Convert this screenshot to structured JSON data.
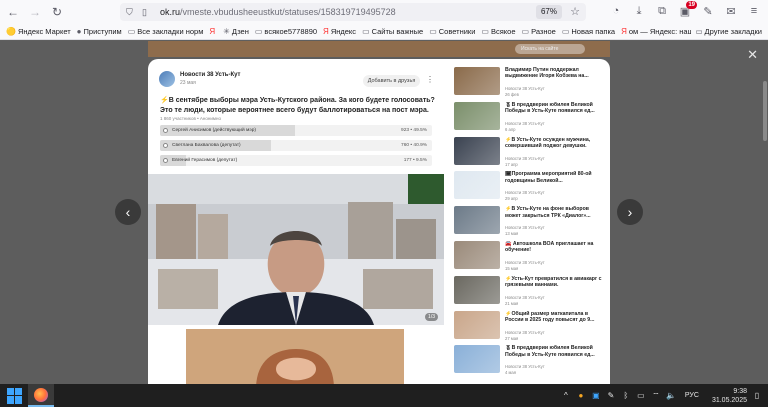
{
  "browser": {
    "url_domain": "ok.ru",
    "url_path": "/vmeste.vbudusheeustkut/statuses/158319719495728",
    "zoom": "67%",
    "notif_badge": "19"
  },
  "bookmarks": {
    "items": [
      {
        "icon": "yandex-icon",
        "label": "Яндекс Маркет"
      },
      {
        "icon": "pin-icon",
        "label": "Приступим"
      },
      {
        "icon": "folder-icon",
        "label": "Все закладки норм"
      },
      {
        "icon": "yandex-icon",
        "label": ""
      },
      {
        "icon": "zen-icon",
        "label": "Дзен"
      },
      {
        "icon": "folder-icon",
        "label": "всякое5778890"
      },
      {
        "icon": "yandex-icon",
        "label": "Яндекс"
      },
      {
        "icon": "folder-icon",
        "label": "Сайты важные"
      },
      {
        "icon": "folder-icon",
        "label": "Советники"
      },
      {
        "icon": "folder-icon",
        "label": "Всякое"
      },
      {
        "icon": "folder-icon",
        "label": "Разное"
      },
      {
        "icon": "folder-icon",
        "label": "Новая папка"
      },
      {
        "icon": "yandex-icon",
        "label": "ом — Яндекс: нашло..."
      }
    ],
    "other": "Другие закладки"
  },
  "page": {
    "search_placeholder": "Искать на сайте"
  },
  "post": {
    "group_name": "Новости 38 Усть-Кут",
    "date": "23 мая",
    "add_friend": "Добавить в друзья",
    "title": "⚡В сентябре выборы мэра Усть-Кутского района. За кого будете голосовать? Это те люди, которые вероятнее всего будут баллотироваться на пост мэра.",
    "poll_meta": "1 860 участников • Анонимно",
    "poll": [
      {
        "label": "Сергей Анисимов (действующий мэр)",
        "value": "923 • 49.5%",
        "percent": 49.5
      },
      {
        "label": "Светлана Бахвалова (депутат)",
        "value": "760 • 40.9%",
        "percent": 40.9
      },
      {
        "label": "Евгений Герасимов (депутат)",
        "value": "177 • 9.5%",
        "percent": 9.5
      }
    ],
    "photo_counter": "1/3"
  },
  "news": [
    {
      "title": "Владимир Путин поддержал выдвижение Игоря Кобзева на...",
      "source": "Новости 38 Усть-Кут",
      "date": "26 фев",
      "thumb": "#8a6a4a"
    },
    {
      "title": "🎖В преддверии юбилея Великой Победы в Усть-Куте появился ед...",
      "source": "Новости 38 Усть-Кут",
      "date": "6 апр",
      "thumb": "#7b8f6b"
    },
    {
      "title": "⚡В Усть-Куте осужден мужчина, совершивший поджог девушки.",
      "source": "Новости 38 Усть-Кут",
      "date": "17 апр",
      "thumb": "#3a4250"
    },
    {
      "title": "🗓Программа мероприятий 80-ой годовщины Великой...",
      "source": "Новости 38 Усть-Кут",
      "date": "29 апр",
      "thumb": "#dfe8f0"
    },
    {
      "title": "⚡В Усть-Куте на фоне выборов может закрыться ТРК «Диалог»...",
      "source": "Новости 38 Усть-Кут",
      "date": "13 мая",
      "thumb": "#6c7a88"
    },
    {
      "title": "🚘 Автошкола ВОА приглашает на обучение!",
      "source": "Новости 38 Усть-Кут",
      "date": "15 мая",
      "thumb": "#9a8a7a"
    },
    {
      "title": "⚡Усть-Кут превратился в авиакарг с грязевыми ваннами.",
      "source": "Новости 38 Усть-Кут",
      "date": "21 мая",
      "thumb": "#6a6860"
    },
    {
      "title": "⚡Общий размер маткапитала в России в 2025 году повысят до 9...",
      "source": "Новости 38 Усть-Кут",
      "date": "27 мая",
      "thumb": "#c9a68a"
    },
    {
      "title": "🎖В преддверии юбилея Великой Победы в Усть-Куте появился ед...",
      "source": "Новости 38 Усть-Кут",
      "date": "4 мая",
      "thumb": "#8ab0d8"
    }
  ],
  "taskbar": {
    "lang": "РУС",
    "time": "9:38",
    "date": "31.05.2025"
  }
}
